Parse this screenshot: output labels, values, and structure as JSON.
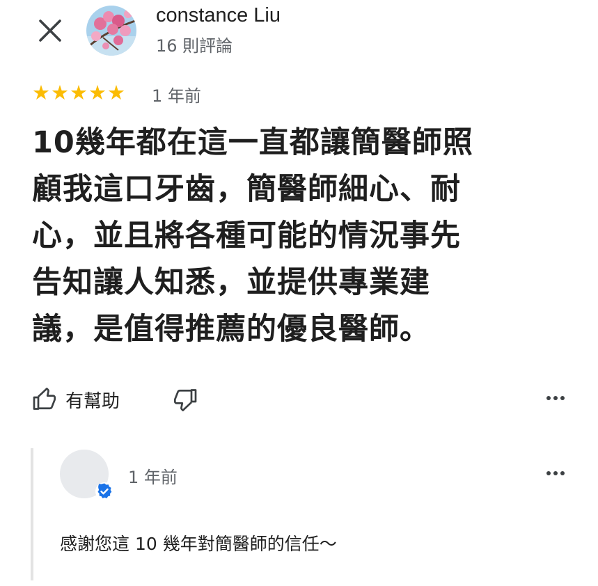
{
  "reviewer": {
    "name": "constance Liu",
    "review_count": "16 則評論"
  },
  "review": {
    "rating": 5,
    "max_rating": 5,
    "star_color": "#fbbc04",
    "time": "1 年前",
    "lines": [
      "10幾年都在這一直都讓簡醫師照",
      "顧我這口牙齒，簡醫師細心、耐",
      "心，並且將各種可能的情況事先",
      "告知讓人知悉，並提供專業建",
      "議，是值得推薦的優良醫師。"
    ]
  },
  "actions": {
    "helpful_label": "有幫助",
    "icons": [
      "thumbs-up-icon",
      "thumbs-down-icon",
      "more-options-icon"
    ]
  },
  "owner_reply": {
    "time": "1 年前",
    "text": "感謝您這 10 幾年對簡醫師的信任～",
    "badge_color": "#1a73e8"
  }
}
